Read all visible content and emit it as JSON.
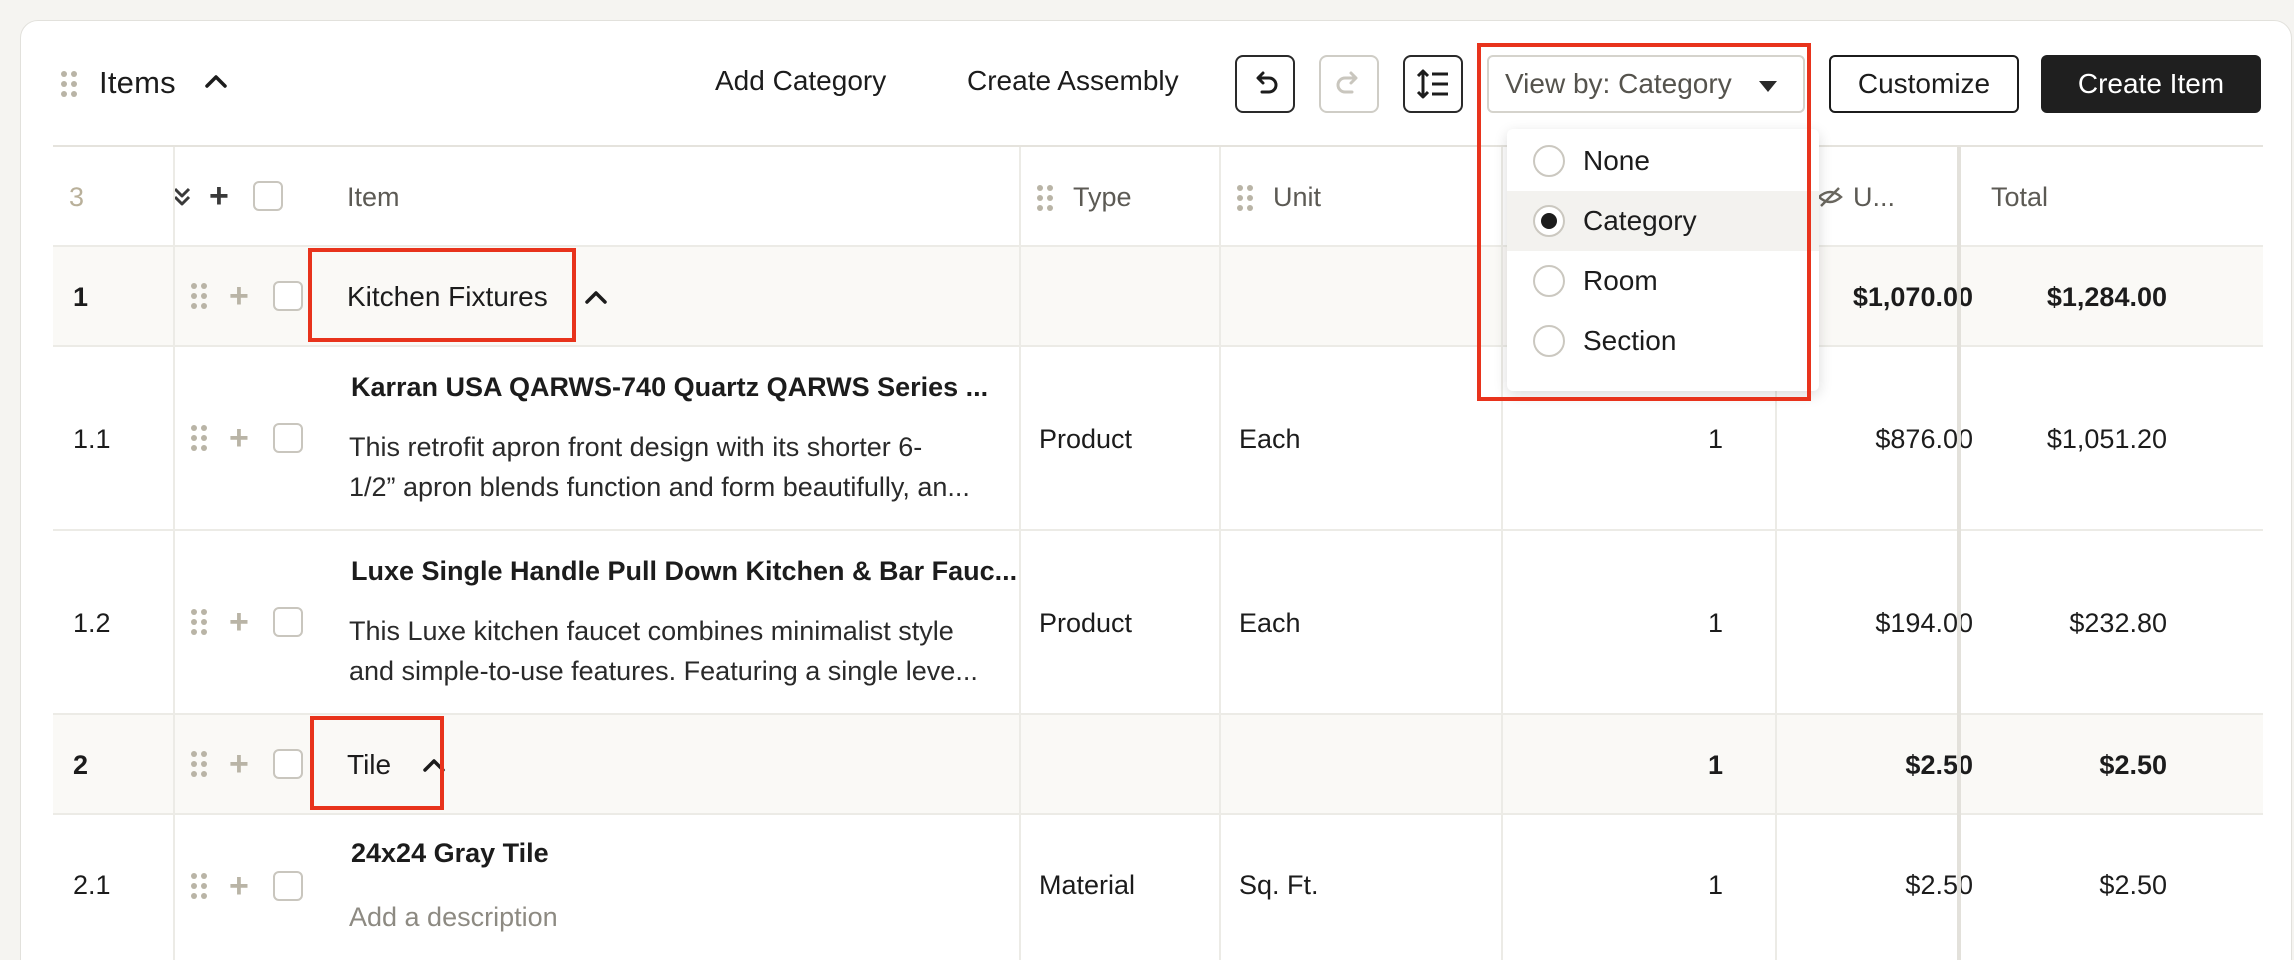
{
  "header": {
    "title": "Items",
    "add_category": "Add Category",
    "create_assembly": "Create Assembly",
    "view_by": "View by: Category",
    "customize": "Customize",
    "create_item": "Create Item"
  },
  "view_menu": {
    "options": [
      "None",
      "Category",
      "Room",
      "Section"
    ],
    "selected": "Category"
  },
  "table": {
    "count": "3",
    "columns": {
      "item": "Item",
      "type": "Type",
      "unit": "Unit",
      "unit_cost": "U...",
      "total": "Total"
    },
    "rows": [
      {
        "num": "1",
        "kind": "group",
        "name": "Kitchen Fixtures",
        "unit_cost": "$1,070.00",
        "total": "$1,284.00"
      },
      {
        "num": "1.1",
        "kind": "item",
        "name": "Karran USA QARWS-740 Quartz QARWS Series ...",
        "desc_line1": "This retrofit apron front design with its shorter 6-",
        "desc_line2": "1/2” apron blends function and form beautifully, an...",
        "type": "Product",
        "unit": "Each",
        "qty": "1",
        "unit_cost": "$876.00",
        "total": "$1,051.20"
      },
      {
        "num": "1.2",
        "kind": "item",
        "name": "Luxe Single Handle Pull Down Kitchen & Bar Fauc...",
        "desc_line1": "This Luxe kitchen faucet combines minimalist style",
        "desc_line2": "and simple-to-use features. Featuring a single leve...",
        "type": "Product",
        "unit": "Each",
        "qty": "1",
        "unit_cost": "$194.00",
        "total": "$232.80"
      },
      {
        "num": "2",
        "kind": "group",
        "name": "Tile",
        "qty": "1",
        "unit_cost": "$2.50",
        "total": "$2.50"
      },
      {
        "num": "2.1",
        "kind": "item",
        "name": "24x24 Gray Tile",
        "desc_placeholder": "Add a description",
        "type": "Material",
        "unit": "Sq. Ft.",
        "qty": "1",
        "unit_cost": "$2.50",
        "total": "$2.50"
      }
    ]
  },
  "colors": {
    "highlight": "#e8331c",
    "primary_button": "#1f1f1f",
    "group_row_bg": "#faf9f6"
  }
}
